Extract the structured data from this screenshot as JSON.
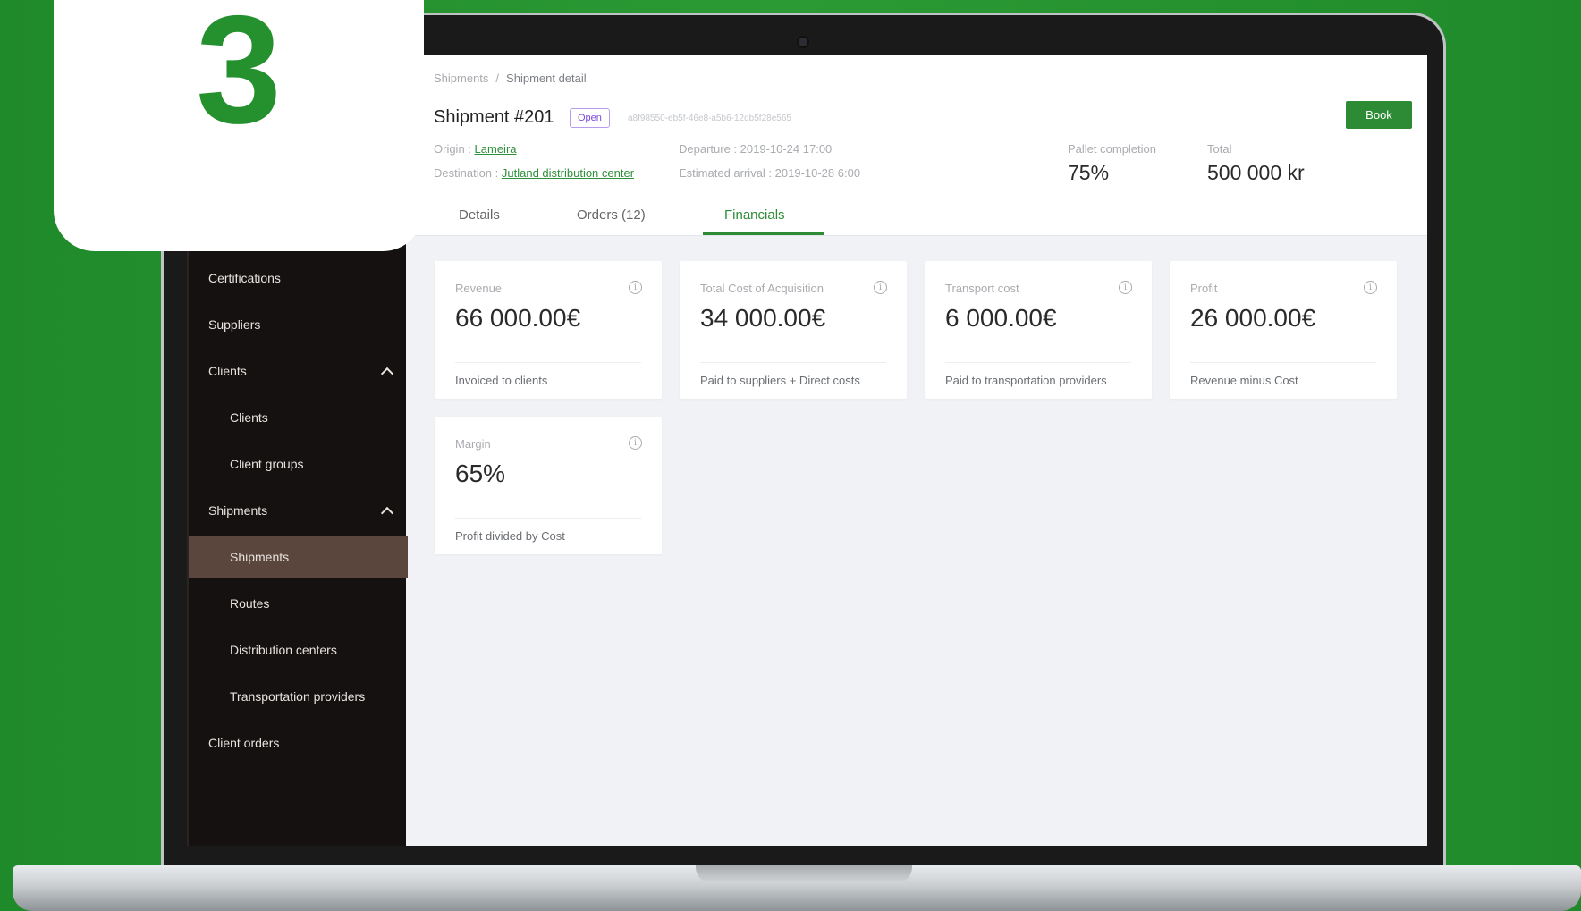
{
  "step": "3",
  "breadcrumb": {
    "parent": "Shipments",
    "separator": "/",
    "current": "Shipment detail"
  },
  "shipment": {
    "title": "Shipment #201",
    "status": "Open",
    "uuid": "a8f98550-eb5f-46e8-a5b6-12db5f28e565",
    "origin_label": "Origin :",
    "origin": "Lameira",
    "destination_label": "Destination :",
    "destination": "Jutland distribution center",
    "departure": "Departure : 2019-10-24 17:00",
    "arrival": "Estimated arrival : 2019-10-28 6:00",
    "pallet_label": "Pallet completion",
    "pallet_value": "75%",
    "total_label": "Total",
    "total_value": "500 000 kr",
    "book_label": "Book"
  },
  "tabs": [
    {
      "label": "Details",
      "active": false
    },
    {
      "label": "Orders (12)",
      "active": false
    },
    {
      "label": "Financials",
      "active": true
    }
  ],
  "sidebar": {
    "items": [
      {
        "label": "Certifications",
        "level": 1
      },
      {
        "label": "Suppliers",
        "level": 1
      },
      {
        "label": "Clients",
        "level": 1,
        "expanded": true
      },
      {
        "label": "Clients",
        "level": 2
      },
      {
        "label": "Client groups",
        "level": 2
      },
      {
        "label": "Shipments",
        "level": 1,
        "expanded": true
      },
      {
        "label": "Shipments",
        "level": 2,
        "active": true
      },
      {
        "label": "Routes",
        "level": 2
      },
      {
        "label": "Distribution centers",
        "level": 2
      },
      {
        "label": "Transportation providers",
        "level": 2
      },
      {
        "label": "Client orders",
        "level": 1
      }
    ]
  },
  "cards": [
    {
      "label": "Revenue",
      "value": "66 000.00€",
      "footer": "Invoiced to clients"
    },
    {
      "label": "Total Cost of Acquisition",
      "value": "34 000.00€",
      "footer": "Paid to suppliers + Direct costs"
    },
    {
      "label": "Transport cost",
      "value": "6 000.00€",
      "footer": "Paid to transportation providers"
    },
    {
      "label": "Profit",
      "value": "26 000.00€",
      "footer": "Revenue minus Cost"
    },
    {
      "label": "Margin",
      "value": "65%",
      "footer": "Profit divided by Cost"
    }
  ],
  "info_glyph": "i",
  "colors": {
    "accent": "#2d8b35",
    "sidebar_bg": "#141110",
    "sidebar_active": "#5a463c",
    "badge": "#7b4ad8"
  }
}
